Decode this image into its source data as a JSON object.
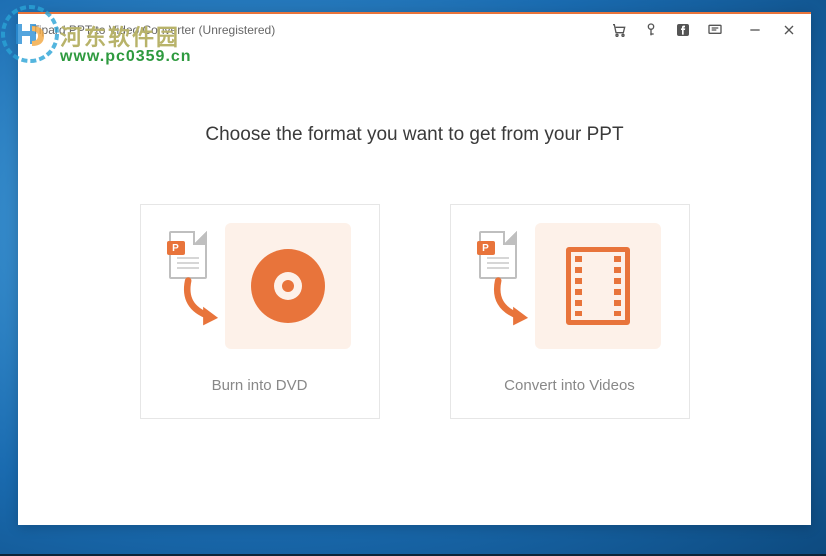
{
  "window": {
    "title": "Tipard PPT to Video Converter (Unregistered)"
  },
  "watermark": {
    "text_cn": "河东软件园",
    "url": "www.pc0359.cn"
  },
  "main": {
    "heading": "Choose the format you want to get from your PPT"
  },
  "options": {
    "dvd": {
      "label": "Burn into DVD"
    },
    "video": {
      "label": "Convert into Videos"
    }
  },
  "toolbar_icons": {
    "cart": "cart",
    "key": "key",
    "facebook": "facebook",
    "feedback": "feedback",
    "minimize": "minimize",
    "close": "close"
  }
}
